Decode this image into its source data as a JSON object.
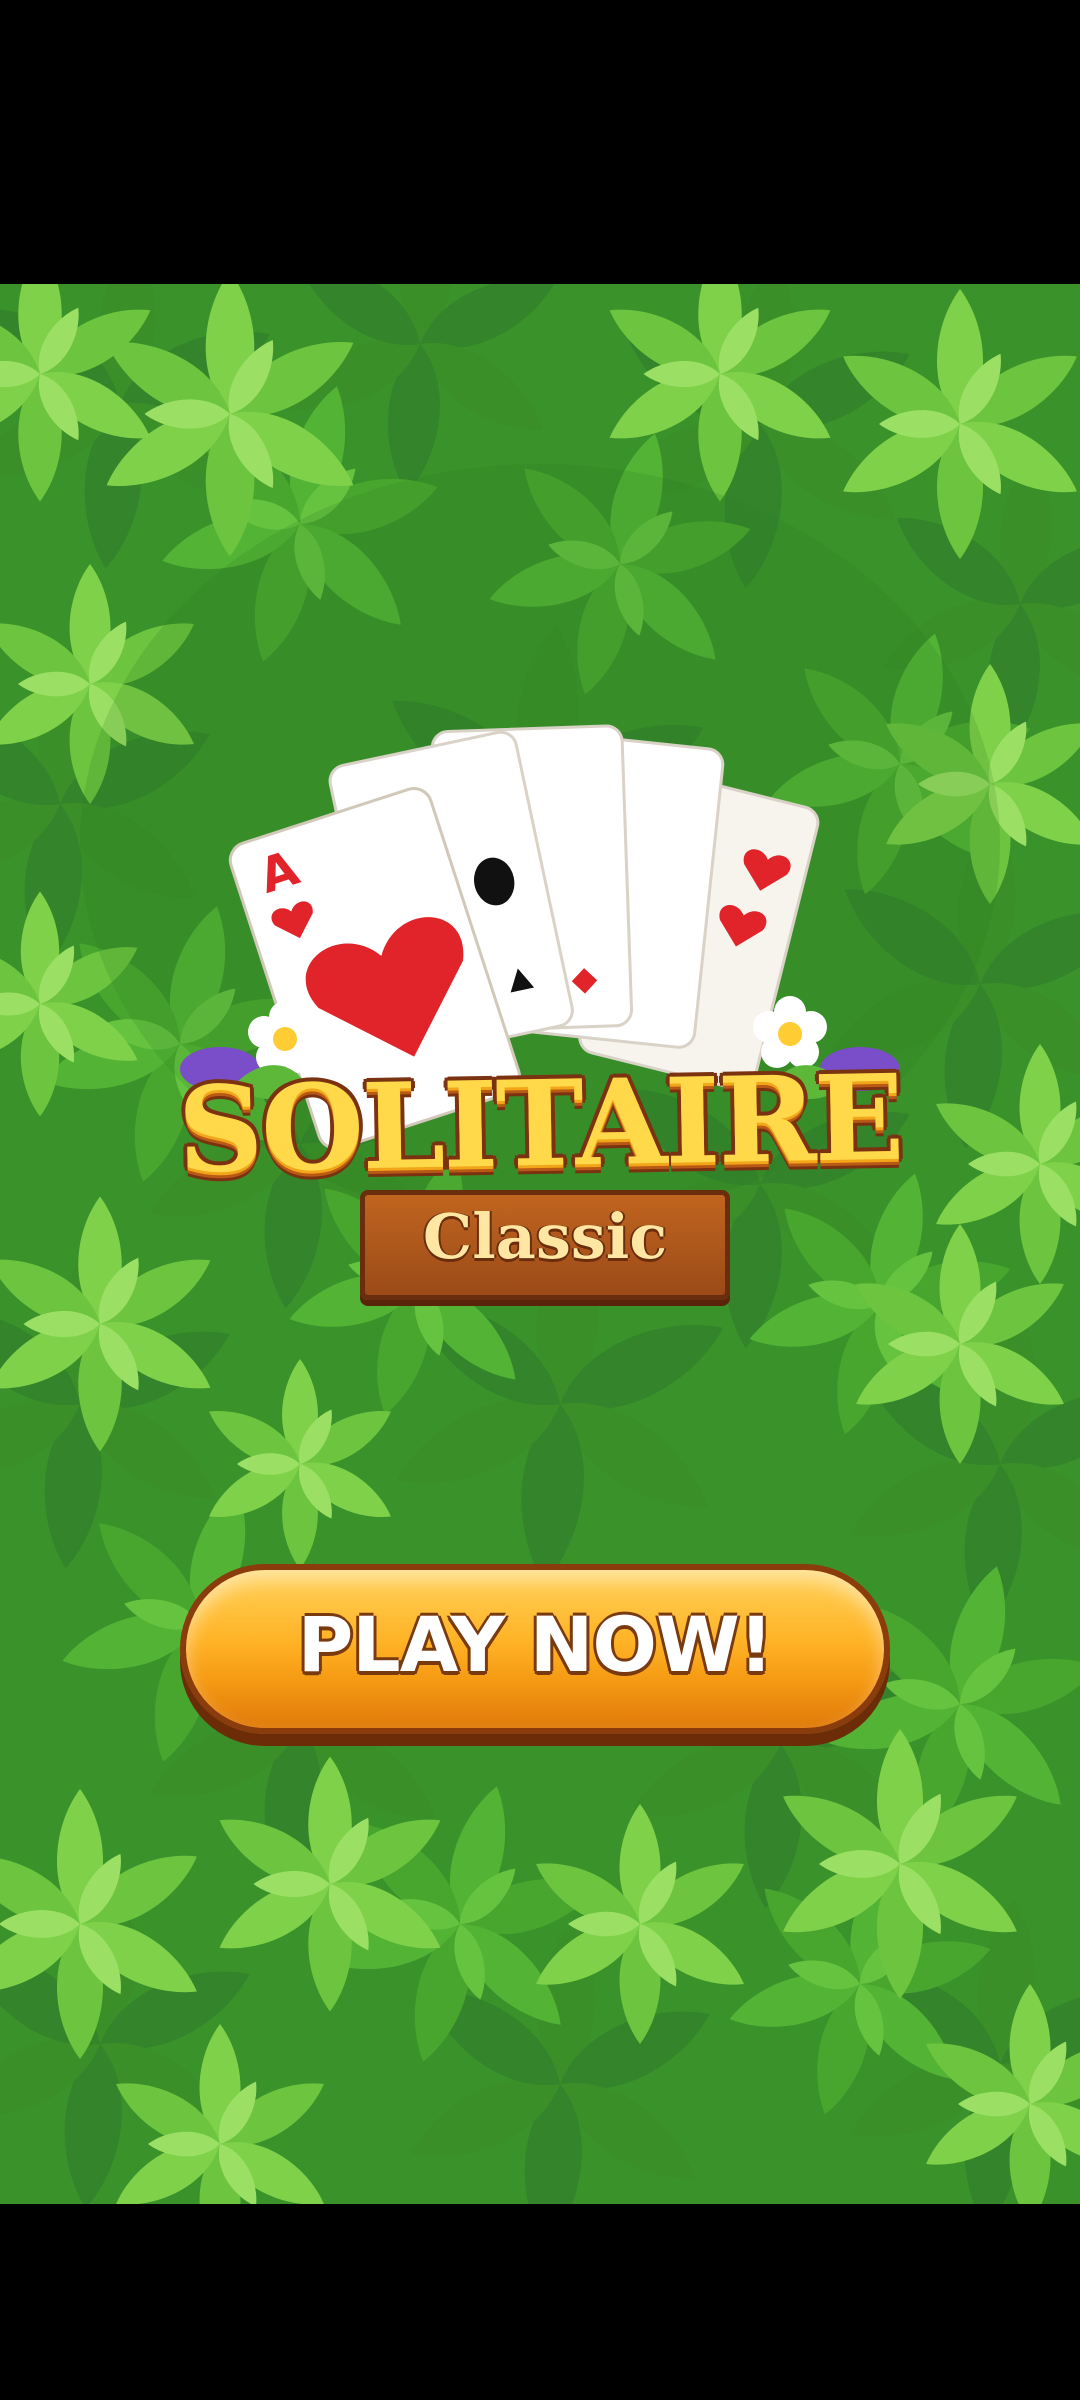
{
  "app": {
    "title": "SOLITAIRE",
    "subtitle": "Classic"
  },
  "cards": {
    "ace_rank": "A"
  },
  "button": {
    "play_label": "PLAY NOW!"
  },
  "colors": {
    "background_green": "#3f9a2e",
    "leaf_light": "#7fd14a",
    "leaf_mid": "#52b335",
    "leaf_dark": "#2d7a20",
    "title_yellow": "#ffd94a",
    "title_outline": "#7a3210",
    "plank_brown": "#c0651f",
    "button_orange": "#ffb326",
    "button_outline": "#8a3c0c",
    "heart_red": "#e0242a"
  },
  "icons": {
    "background": "leaf-pattern-icon",
    "flower": "daisy-flower-icon",
    "heart": "heart-suit-icon",
    "spade": "spade-suit-icon",
    "diamond": "diamond-suit-icon"
  }
}
